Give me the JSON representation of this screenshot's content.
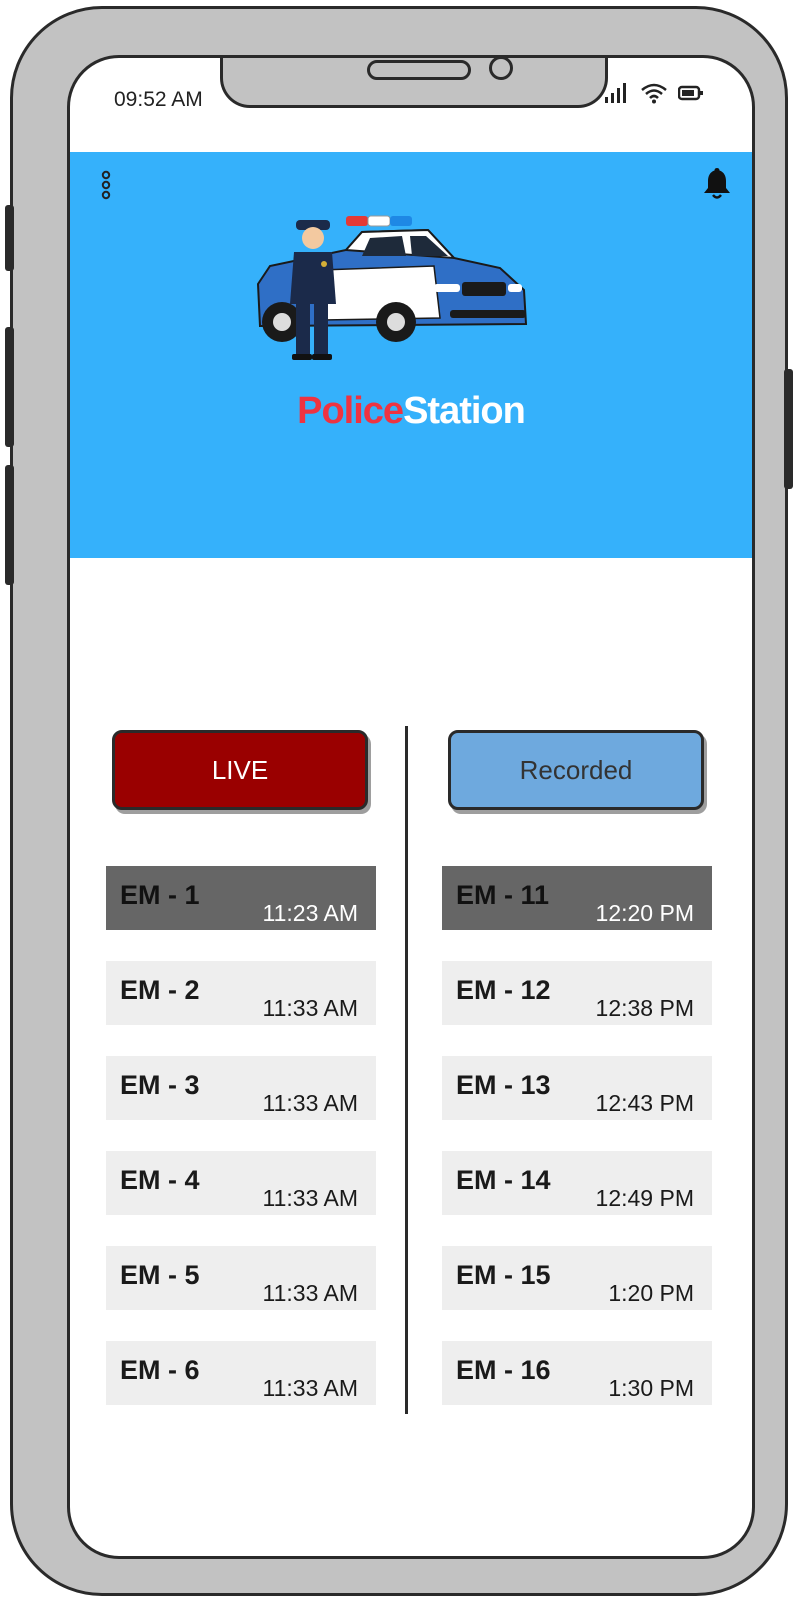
{
  "status_bar": {
    "time": "09:52 AM",
    "icons": [
      "signal-icon",
      "wifi-icon",
      "battery-icon"
    ]
  },
  "header": {
    "background_color": "#35b1fb",
    "menu_icon": "more-vertical-icon",
    "notification_icon": "bell-icon",
    "logo": {
      "part1": "Police",
      "part2": "Station",
      "part1_color": "#ee3341",
      "part2_color": "#ffffff"
    },
    "illustration": "police-officer-and-car"
  },
  "tabs": {
    "live_label": "LIVE",
    "recorded_label": "Recorded",
    "live_color": "#9a0000",
    "recorded_color": "#6ea9de"
  },
  "live_list": [
    {
      "name": "EM - 1",
      "time": "11:23 AM",
      "selected": true
    },
    {
      "name": "EM - 2",
      "time": "11:33 AM"
    },
    {
      "name": "EM - 3",
      "time": "11:33 AM"
    },
    {
      "name": "EM - 4",
      "time": "11:33 AM"
    },
    {
      "name": "EM - 5",
      "time": "11:33 AM"
    },
    {
      "name": "EM - 6",
      "time": "11:33 AM"
    }
  ],
  "recorded_list": [
    {
      "name": "EM - 11",
      "time": "12:20 PM",
      "selected": true
    },
    {
      "name": "EM - 12",
      "time": "12:38 PM"
    },
    {
      "name": "EM - 13",
      "time": "12:43 PM"
    },
    {
      "name": "EM - 14",
      "time": "12:49 PM"
    },
    {
      "name": "EM - 15",
      "time": "1:20 PM"
    },
    {
      "name": "EM - 16",
      "time": "1:30 PM"
    }
  ]
}
